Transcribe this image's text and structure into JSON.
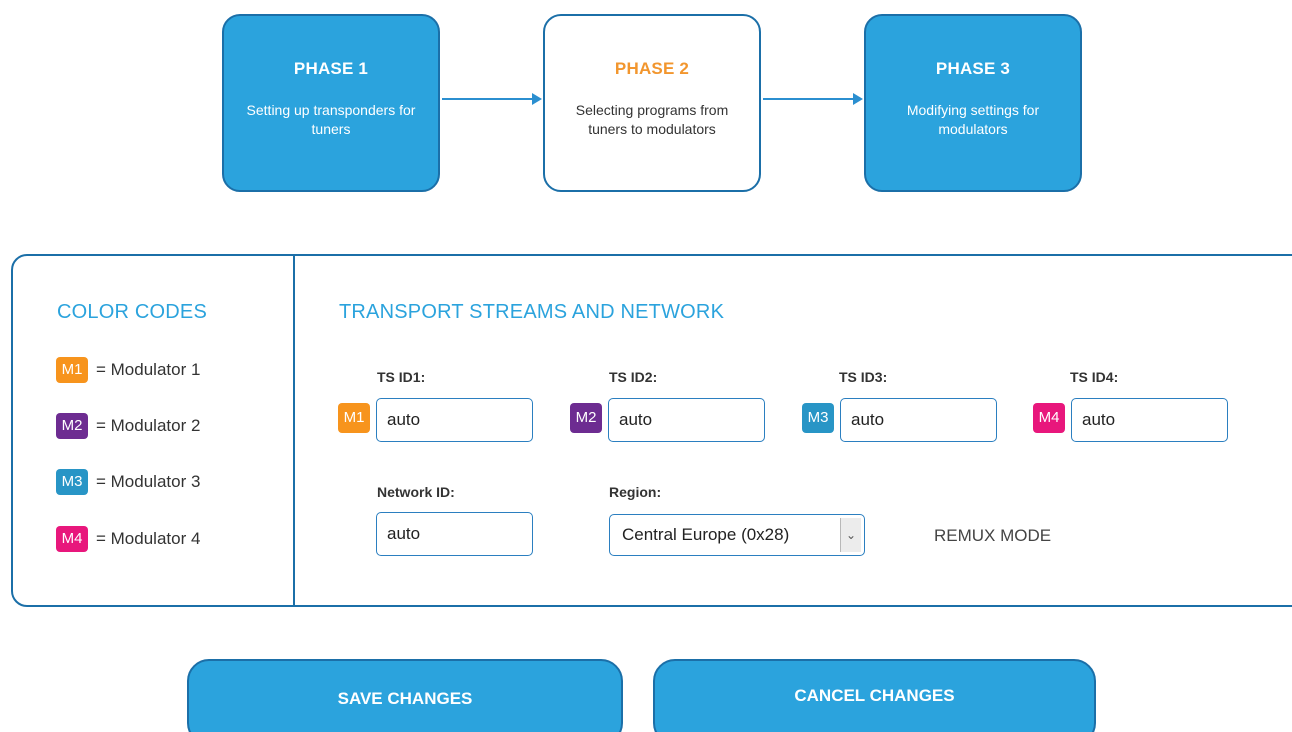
{
  "phases": [
    {
      "title": "PHASE 1",
      "desc": "Setting up transponders for tuners"
    },
    {
      "title": "PHASE 2",
      "desc": "Selecting programs from tuners to modulators"
    },
    {
      "title": "PHASE 3",
      "desc": "Modifying settings for modulators"
    }
  ],
  "color_codes": {
    "title": "COLOR CODES",
    "items": [
      {
        "badge": "M1",
        "label": "= Modulator 1",
        "color": "#f7941d"
      },
      {
        "badge": "M2",
        "label": "= Modulator 2",
        "color": "#6d2c91"
      },
      {
        "badge": "M3",
        "label": "= Modulator 3",
        "color": "#2895c6"
      },
      {
        "badge": "M4",
        "label": "= Modulator 4",
        "color": "#e8177c"
      }
    ]
  },
  "ts_section": {
    "title": "TRANSPORT STREAMS AND NETWORK",
    "ts_ids": [
      {
        "label": "TS ID1:",
        "badge": "M1",
        "value": "auto"
      },
      {
        "label": "TS ID2:",
        "badge": "M2",
        "value": "auto"
      },
      {
        "label": "TS ID3:",
        "badge": "M3",
        "value": "auto"
      },
      {
        "label": "TS ID4:",
        "badge": "M4",
        "value": "auto"
      }
    ],
    "network_id": {
      "label": "Network ID:",
      "value": "auto"
    },
    "region": {
      "label": "Region:",
      "value": "Central Europe (0x28)"
    },
    "remux_mode": "REMUX MODE"
  },
  "buttons": {
    "save": "SAVE CHANGES",
    "cancel": "CANCEL CHANGES"
  },
  "colors": {
    "accent": "#2ba3dd",
    "border": "#1b6fa8",
    "current_phase_title": "#f2962e"
  }
}
